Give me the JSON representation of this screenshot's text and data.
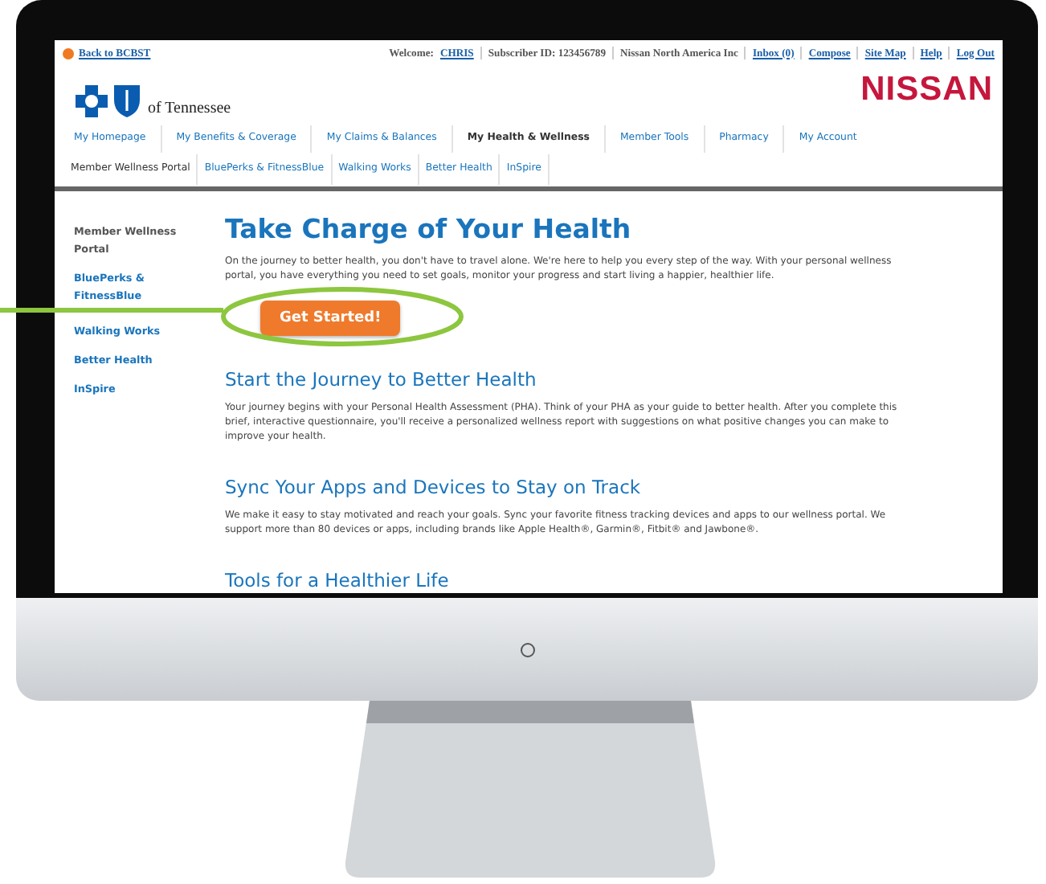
{
  "top_bar": {
    "back_link": "Back to BCBST",
    "welcome_label": "Welcome:",
    "user_link": "CHRIS",
    "subscriber": "Subscriber ID: 123456789",
    "company": "Nissan North America Inc",
    "links": [
      "Inbox (0)",
      "Compose",
      "Site Map",
      "Help",
      "Log Out"
    ]
  },
  "header": {
    "logo_text": "of Tennessee",
    "brand": "NISSAN"
  },
  "main_nav": [
    {
      "label": "My Homepage",
      "selected": false
    },
    {
      "label": "My Benefits & Coverage",
      "selected": false
    },
    {
      "label": "My Claims & Balances",
      "selected": false
    },
    {
      "label": "My Health & Wellness",
      "selected": true
    },
    {
      "label": "Member Tools",
      "selected": false
    },
    {
      "label": "Pharmacy",
      "selected": false
    },
    {
      "label": "My Account",
      "selected": false
    }
  ],
  "sub_nav": [
    {
      "label": "Member Wellness Portal",
      "selected": true
    },
    {
      "label": "BluePerks & FitnessBlue",
      "selected": false
    },
    {
      "label": "Walking Works",
      "selected": false
    },
    {
      "label": "Better Health",
      "selected": false
    },
    {
      "label": "InSpire",
      "selected": false
    }
  ],
  "sidebar": {
    "items": [
      {
        "label": "Member Wellness Portal",
        "selected": true
      },
      {
        "label": "BluePerks & FitnessBlue",
        "selected": false
      },
      {
        "label": "Walking Works",
        "selected": false
      },
      {
        "label": "Better Health",
        "selected": false
      },
      {
        "label": "InSpire",
        "selected": false
      }
    ]
  },
  "content": {
    "title": "Take Charge of Your Health",
    "intro": "On the journey to better health, you don't have to travel alone. We're here to help you every step of the way. With your personal wellness portal, you have everything you need to set goals, monitor your progress and start living a happier, healthier life.",
    "button": "Get Started!",
    "sections": [
      {
        "heading": "Start the Journey to Better Health",
        "text": "Your journey begins with your Personal Health Assessment (PHA). Think of your PHA as your guide to better health. After you complete this brief, interactive questionnaire, you'll receive a personalized wellness report with suggestions on what positive changes you can make to improve your health."
      },
      {
        "heading": "Sync Your Apps and Devices to Stay on Track",
        "text": "We make it easy to stay motivated and reach your goals. Sync your favorite fitness tracking devices and apps to our wellness portal. We support more than 80 devices or apps, including brands like Apple Health®, Garmin®, Fitbit® and Jawbone®."
      },
      {
        "heading": "Tools for a Healthier Life"
      }
    ]
  }
}
